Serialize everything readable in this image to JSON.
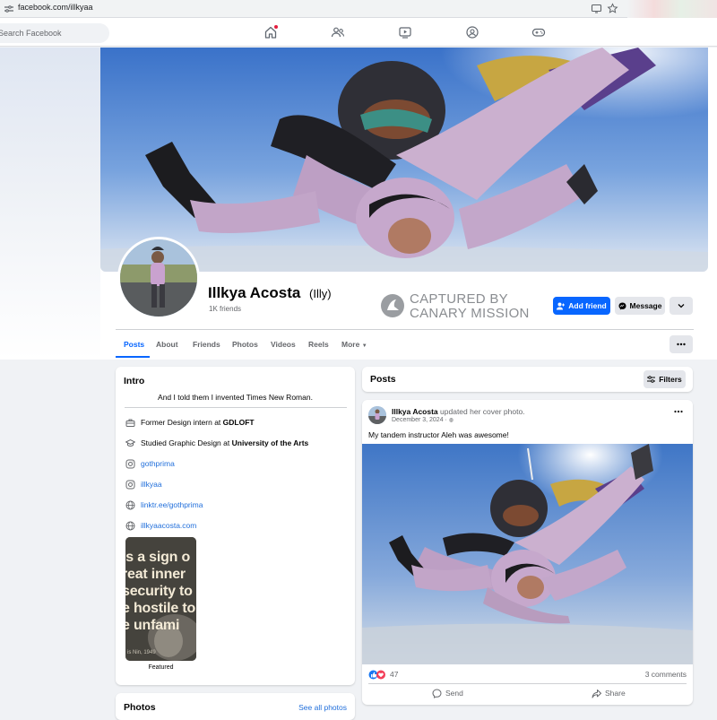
{
  "browser": {
    "url": "facebook.com/illkyaa",
    "icons": [
      "site-settings-icon",
      "cast-icon",
      "bookmark-star-icon"
    ]
  },
  "nav": {
    "search_placeholder": "Search Facebook",
    "icons": [
      "home-icon",
      "friends-icon",
      "video-icon",
      "groups-icon",
      "gaming-icon"
    ]
  },
  "profile": {
    "name": "Illkya Acosta",
    "alt_name": "(Illy)",
    "friends": "1K friends",
    "add_friend_label": "Add friend",
    "message_label": "Message"
  },
  "watermark": {
    "line1": "CAPTURED BY",
    "line2": "CANARY MISSION"
  },
  "tabs": [
    "Posts",
    "About",
    "Friends",
    "Photos",
    "Videos",
    "Reels",
    "More"
  ],
  "intro": {
    "title": "Intro",
    "bio": "And I told them I invented Times New Roman.",
    "work_prefix": "Former Design intern at",
    "work_org": "GDLOFT",
    "edu_prefix": "Studied Graphic Design at",
    "edu_org": "University of the Arts",
    "links": [
      "gothprima",
      "illkyaa",
      "linktr.ee/gothprima",
      "illkyaacosta.com"
    ],
    "featured_label": "Featured",
    "featured_lines": [
      "is a sign o",
      "reat inner",
      "security to",
      "e hostile to",
      "e unfami"
    ],
    "featured_caption": "is Nin, 1949"
  },
  "photos": {
    "title": "Photos",
    "see_all": "See all photos"
  },
  "posts": {
    "title": "Posts",
    "filters_label": "Filters"
  },
  "post": {
    "author": "Illkya Acosta",
    "action": "updated her cover photo.",
    "date": "December 3, 2024 ·",
    "text": "My tandem instructor Aleh was awesome!",
    "reaction_count": "47",
    "comments": "3 comments",
    "send_label": "Send",
    "share_label": "Share"
  },
  "colors": {
    "accent": "#0866ff",
    "link": "#216fdb",
    "background": "#f0f2f5"
  }
}
